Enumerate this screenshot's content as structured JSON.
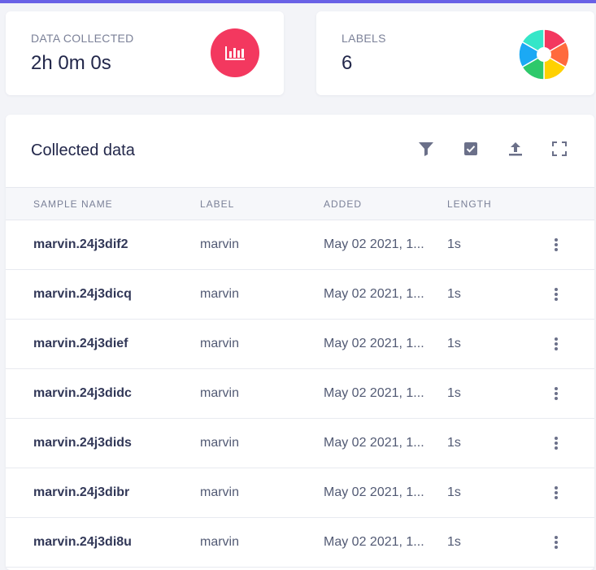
{
  "stats": {
    "collected": {
      "label": "DATA COLLECTED",
      "value": "2h 0m 0s",
      "icon": "bar-chart-icon",
      "color": "#f3385f"
    },
    "labels": {
      "label": "LABELS",
      "value": "6",
      "icon": "label-distribution-pie-icon",
      "colors": [
        "#f3385f",
        "#ff6a3d",
        "#ffd100",
        "#2ec96b",
        "#1ba9f4",
        "#35e6c8"
      ]
    }
  },
  "panel": {
    "title": "Collected data",
    "toolbar": [
      "filter-icon",
      "select-icon",
      "upload-icon",
      "fullscreen-icon"
    ]
  },
  "table": {
    "headers": {
      "name": "SAMPLE NAME",
      "label": "LABEL",
      "added": "ADDED",
      "length": "LENGTH"
    },
    "rows": [
      {
        "name": "marvin.24j3dif2",
        "label": "marvin",
        "added": "May 02 2021, 1...",
        "length": "1s"
      },
      {
        "name": "marvin.24j3dicq",
        "label": "marvin",
        "added": "May 02 2021, 1...",
        "length": "1s"
      },
      {
        "name": "marvin.24j3dief",
        "label": "marvin",
        "added": "May 02 2021, 1...",
        "length": "1s"
      },
      {
        "name": "marvin.24j3didc",
        "label": "marvin",
        "added": "May 02 2021, 1...",
        "length": "1s"
      },
      {
        "name": "marvin.24j3dids",
        "label": "marvin",
        "added": "May 02 2021, 1...",
        "length": "1s"
      },
      {
        "name": "marvin.24j3dibr",
        "label": "marvin",
        "added": "May 02 2021, 1...",
        "length": "1s"
      },
      {
        "name": "marvin.24j3di8u",
        "label": "marvin",
        "added": "May 02 2021, 1...",
        "length": "1s"
      }
    ]
  },
  "colors": {
    "accent": "#6a62e6",
    "text": "#323858",
    "muted": "#7b8198"
  }
}
